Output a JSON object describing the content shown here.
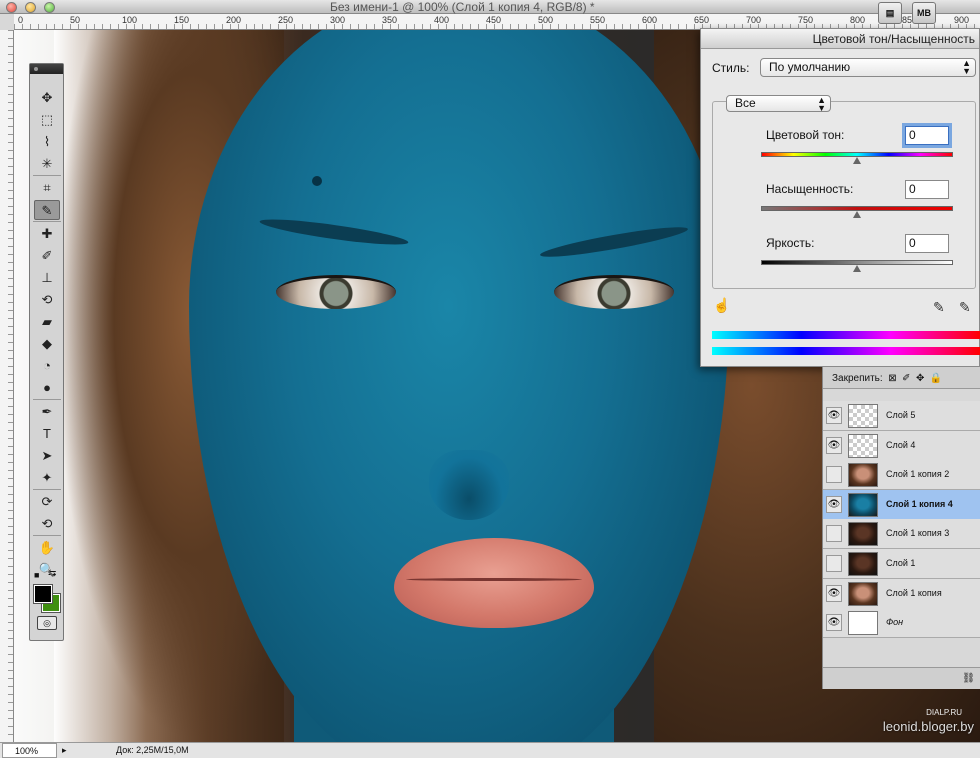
{
  "window": {
    "title": "Без имени-1 @ 100% (Слой 1 копия 4, RGB/8) *",
    "top_buttons": [
      "▤",
      "MB"
    ]
  },
  "ruler": {
    "top_ticks": [
      "0",
      "50",
      "100",
      "150",
      "200",
      "250",
      "300",
      "350",
      "400",
      "450",
      "500",
      "550",
      "600",
      "650",
      "700",
      "750",
      "800",
      "850",
      "900"
    ]
  },
  "tools": [
    "move-tool",
    "marquee-tool",
    "lasso-tool",
    "magic-wand-tool",
    "crop-tool",
    "eyedropper-tool",
    "healing-tool",
    "brush-tool",
    "stamp-tool",
    "history-brush-tool",
    "eraser-tool",
    "bucket-tool",
    "blur-tool",
    "dodge-tool",
    "pen-tool",
    "type-tool",
    "path-select-tool",
    "shape-tool",
    "3d-rotate-tool",
    "3d-orbit-tool",
    "hand-tool",
    "zoom-tool"
  ],
  "tool_glyphs": [
    "✥",
    "⬚",
    "⌇",
    "✳",
    "⌗",
    "✎",
    "✚",
    "✐",
    "⊥",
    "⟲",
    "▰",
    "◆",
    "◔",
    "●",
    "✒",
    "T",
    "➤",
    "✦",
    "⟳",
    "⟲",
    "✋",
    "🔍"
  ],
  "dialog": {
    "title": "Цветовой тон/Насыщенность",
    "style_label": "Стиль:",
    "style_value": "По умолчанию",
    "channel_value": "Все",
    "hue_label": "Цветовой тон:",
    "hue_value": "0",
    "saturation_label": "Насыщенность:",
    "saturation_value": "0",
    "lightness_label": "Яркость:",
    "lightness_value": "0"
  },
  "layers_panel": {
    "lock_label": "Закрепить:",
    "layers": [
      {
        "name": "Слой 5",
        "visible": true,
        "thumb": "check",
        "selected": false
      },
      {
        "name": "Слой 4",
        "visible": true,
        "thumb": "check",
        "selected": false
      },
      {
        "name": "Слой 1 копия 2",
        "visible": false,
        "thumb": "face",
        "selected": false
      },
      {
        "name": "Слой 1 копия 4",
        "visible": true,
        "thumb": "blue",
        "selected": true
      },
      {
        "name": "Слой 1 копия 3",
        "visible": false,
        "thumb": "dark",
        "selected": false
      },
      {
        "name": "Слой 1",
        "visible": false,
        "thumb": "dark",
        "selected": false
      },
      {
        "name": "Слой 1 копия",
        "visible": true,
        "thumb": "face",
        "selected": false
      },
      {
        "name": "Фон",
        "visible": true,
        "thumb": "white",
        "selected": false
      }
    ]
  },
  "status": {
    "zoom": "100%",
    "doc_info": "Док: 2,25M/15,0M"
  },
  "watermark": {
    "site_small": "DIALP.RU",
    "blog": "leonid.bloger.by"
  }
}
